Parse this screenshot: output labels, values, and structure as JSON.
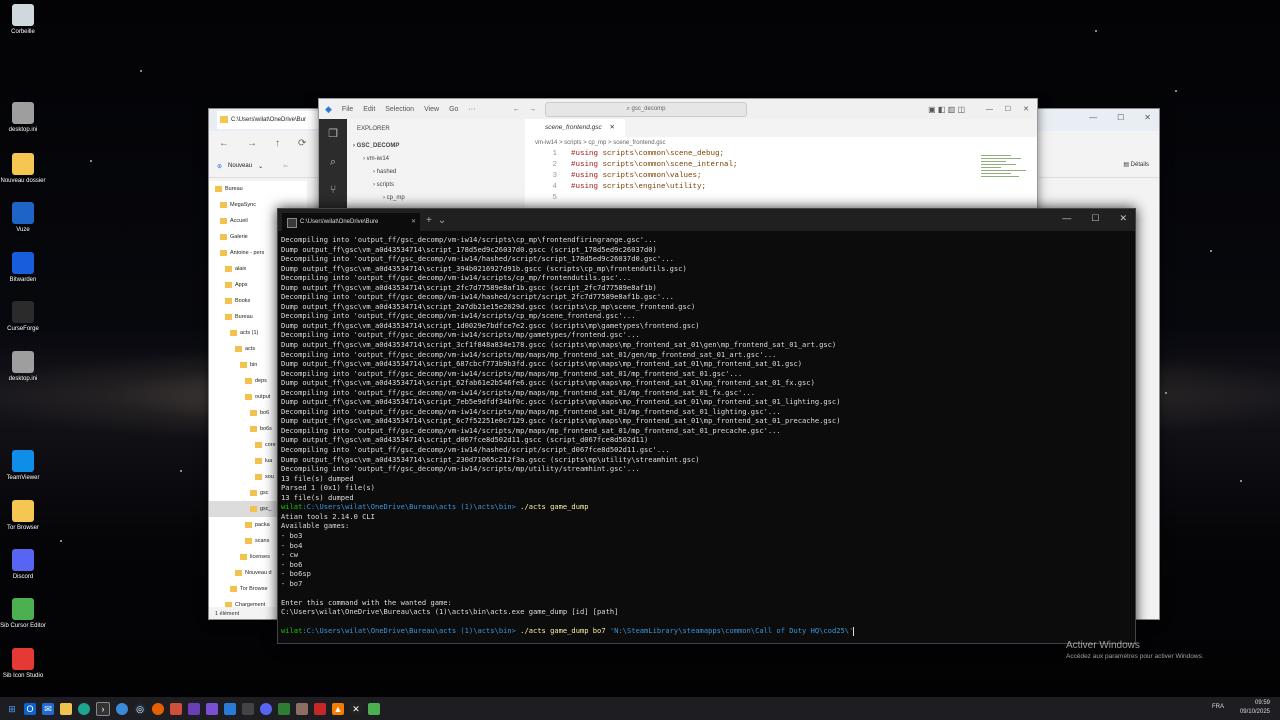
{
  "desktop": {
    "icons": [
      {
        "label": "Corbeille",
        "icon": "recycle-bin-icon",
        "color": "#cfd8dc"
      },
      {
        "label": "desktop.ini",
        "icon": "file-icon",
        "color": "#9e9e9e"
      },
      {
        "label": "Nouveau dossier",
        "icon": "folder-icon",
        "color": "#f6c652"
      },
      {
        "label": "Vuze",
        "icon": "vuze-icon",
        "color": "#1e63c6"
      },
      {
        "label": "Bitwarden",
        "icon": "bitwarden-icon",
        "color": "#175ddc"
      },
      {
        "label": "CurseForge",
        "icon": "curseforge-icon",
        "color": "#2b2b2b"
      },
      {
        "label": "desktop.ini",
        "icon": "file-icon",
        "color": "#9e9e9e"
      },
      {
        "label": "TeamViewer",
        "icon": "teamviewer-icon",
        "color": "#0e8ee9"
      },
      {
        "label": "Tor Browser",
        "icon": "folder-icon",
        "color": "#f6c652"
      },
      {
        "label": "Discord",
        "icon": "discord-icon",
        "color": "#5865f2"
      },
      {
        "label": "Sib Cursor Editor",
        "icon": "cursor-editor-icon",
        "color": "#4caf50"
      },
      {
        "label": "Sib Icon Studio",
        "icon": "icon-studio-icon",
        "color": "#e53935"
      }
    ]
  },
  "explorer": {
    "tab_title": "C:\\Users\\wilat\\OneDrive\\Bur",
    "new_label": "Nouveau",
    "details_label": "Détails",
    "status": "1 élément",
    "tree": [
      {
        "label": "Bureau",
        "indent": 0
      },
      {
        "label": "MegaSync",
        "indent": 1
      },
      {
        "label": "Accueil",
        "indent": 1
      },
      {
        "label": "Galerie",
        "indent": 1
      },
      {
        "label": "Antoine - pers",
        "indent": 1
      },
      {
        "label": "alaix",
        "indent": 2
      },
      {
        "label": "Apps",
        "indent": 2
      },
      {
        "label": "Books",
        "indent": 2
      },
      {
        "label": "Bureau",
        "indent": 2
      },
      {
        "label": "acts (1)",
        "indent": 3
      },
      {
        "label": "acts",
        "indent": 4
      },
      {
        "label": "bin",
        "indent": 5
      },
      {
        "label": "deps",
        "indent": 6
      },
      {
        "label": "output",
        "indent": 6
      },
      {
        "label": "bo6",
        "indent": 7
      },
      {
        "label": "bo6s",
        "indent": 7
      },
      {
        "label": "core",
        "indent": 8
      },
      {
        "label": "lua",
        "indent": 8
      },
      {
        "label": "sou",
        "indent": 8
      },
      {
        "label": "gsc",
        "indent": 7
      },
      {
        "label": "gsc_",
        "indent": 7
      },
      {
        "label": "packa",
        "indent": 6
      },
      {
        "label": "scans",
        "indent": 6
      },
      {
        "label": "licenses",
        "indent": 5
      },
      {
        "label": "Nouveau d",
        "indent": 4
      },
      {
        "label": "Tor Browse",
        "indent": 3
      },
      {
        "label": "Chargement",
        "indent": 2
      }
    ]
  },
  "vscode": {
    "menu": [
      "File",
      "Edit",
      "Selection",
      "View",
      "Go",
      "···"
    ],
    "search": "gsc_decomp",
    "explorer_label": "EXPLORER",
    "tree": [
      {
        "label": "GSC_DECOMP",
        "indent": 0
      },
      {
        "label": "vm-iw14",
        "indent": 1
      },
      {
        "label": "hashed",
        "indent": 2
      },
      {
        "label": "scripts",
        "indent": 2
      },
      {
        "label": "cp_mp",
        "indent": 3
      }
    ],
    "tab": "scene_frontend.gsc",
    "breadcrumb": "vm-iw14 > scripts > cp_mp > scene_frontend.gsc",
    "code": [
      {
        "n": "1",
        "kw": "#using",
        "path": "scripts\\common\\scene_debug;"
      },
      {
        "n": "2",
        "kw": "#using",
        "path": "scripts\\common\\scene_internal;"
      },
      {
        "n": "3",
        "kw": "#using",
        "path": "scripts\\common\\values;"
      },
      {
        "n": "4",
        "kw": "#using",
        "path": "scripts\\engine\\utility;"
      },
      {
        "n": "5",
        "kw": "",
        "path": ""
      }
    ]
  },
  "terminal": {
    "tab_title": "C:\\Users\\wilat\\OneDrive\\Bure",
    "lines": [
      "Decompiling into 'output_ff/gsc_decomp/vm-iw14/scripts\\cp_mp\\frontendfiringrange.gsc'...",
      "Dump output_ff\\gsc\\vm_a0d43534714\\script_178d5ed9c26037d0.gscc (script_178d5ed9c26037d0)",
      "Decompiling into 'output_ff/gsc_decomp/vm-iw14/hashed/script/script_178d5ed9c26037d0.gsc'...",
      "Dump output_ff\\gsc\\vm_a0d43534714\\script_394b0216927d91b.gscc (scripts\\cp_mp\\frontendutils.gsc)",
      "Decompiling into 'output_ff/gsc_decomp/vm-iw14/scripts/cp_mp/frontendutils.gsc'...",
      "Dump output_ff\\gsc\\vm_a0d43534714\\script_2fc7d77589e8af1b.gscc (script_2fc7d77589e8af1b)",
      "Decompiling into 'output_ff/gsc_decomp/vm-iw14/hashed/script/script_2fc7d77589e8af1b.gsc'...",
      "Dump output_ff\\gsc\\vm_a0d43534714\\script_2a7db21e15e2029d.gscc (scripts\\cp_mp\\scene_frontend.gsc)",
      "Decompiling into 'output_ff/gsc_decomp/vm-iw14/scripts/cp_mp/scene_frontend.gsc'...",
      "Dump output_ff\\gsc\\vm_a0d43534714\\script_1d0029e7bdfce7e2.gscc (scripts\\mp\\gametypes\\frontend.gsc)",
      "Decompiling into 'output_ff/gsc_decomp/vm-iw14/scripts/mp/gametypes/frontend.gsc'...",
      "Dump output_ff\\gsc\\vm_a0d43534714\\script_3cf1f848a834e178.gscc (scripts\\mp\\maps\\mp_frontend_sat_01\\gen\\mp_frontend_sat_01_art.gsc)",
      "Decompiling into 'output_ff/gsc_decomp/vm-iw14/scripts/mp/maps/mp_frontend_sat_01/gen/mp_frontend_sat_01_art.gsc'...",
      "Dump output_ff\\gsc\\vm_a0d43534714\\script_687cbcf773b9b3fd.gscc (scripts\\mp\\maps\\mp_frontend_sat_01\\mp_frontend_sat_01.gsc)",
      "Decompiling into 'output_ff/gsc_decomp/vm-iw14/scripts/mp/maps/mp_frontend_sat_01/mp_frontend_sat_01.gsc'...",
      "Dump output_ff\\gsc\\vm_a0d43534714\\script_62fab61e2b546fe6.gscc (scripts\\mp\\maps\\mp_frontend_sat_01\\mp_frontend_sat_01_fx.gsc)",
      "Decompiling into 'output_ff/gsc_decomp/vm-iw14/scripts/mp/maps/mp_frontend_sat_01/mp_frontend_sat_01_fx.gsc'...",
      "Dump output_ff\\gsc\\vm_a0d43534714\\script_7eb5e9dfdf34bf0c.gscc (scripts\\mp\\maps\\mp_frontend_sat_01\\mp_frontend_sat_01_lighting.gsc)",
      "Decompiling into 'output_ff/gsc_decomp/vm-iw14/scripts/mp/maps/mp_frontend_sat_01/mp_frontend_sat_01_lighting.gsc'...",
      "Dump output_ff\\gsc\\vm_a0d43534714\\script_6c7f52251e0c7129.gscc (scripts\\mp\\maps\\mp_frontend_sat_01\\mp_frontend_sat_01_precache.gsc)",
      "Decompiling into 'output_ff/gsc_decomp/vm-iw14/scripts/mp/maps/mp_frontend_sat_01/mp_frontend_sat_01_precache.gsc'...",
      "Dump output_ff\\gsc\\vm_a0d43534714\\script_d067fce8d502d11.gscc (script_d067fce8d502d11)",
      "Decompiling into 'output_ff/gsc_decomp/vm-iw14/hashed/script/script_d067fce8d502d11.gsc'...",
      "Dump output_ff\\gsc\\vm_a0d43534714\\script_230d71065c212f3a.gscc (scripts\\mp\\utility\\streamhint.gsc)",
      "Decompiling into 'output_ff/gsc_decomp/vm-iw14/scripts/mp/utility/streamhint.gsc'...",
      "13 file(s) dumped",
      "Parsed 1 (0x1) file(s)",
      "13 file(s) dumped"
    ],
    "prompt1": {
      "user": "wilat",
      "path": ":C:\\Users\\wilat\\OneDrive\\Bureau\\acts (1)\\acts\\bin>",
      "cmd": " ./acts game_dump"
    },
    "output2": [
      "Atian tools 2.14.0 CLI",
      "Available games:",
      "- bo3",
      "- bo4",
      "- cw",
      "- bo6",
      "- bo6sp",
      "- bo7",
      "",
      "Enter this command with the wanted game:",
      "C:\\Users\\wilat\\OneDrive\\Bureau\\acts (1)\\acts\\bin\\acts.exe game_dump [id] [path]"
    ],
    "prompt2": {
      "user": "wilat",
      "path": ":C:\\Users\\wilat\\OneDrive\\Bureau\\acts (1)\\acts\\bin>",
      "cmd": " ./acts game_dump bo7 ",
      "arg": "'N:\\SteamLibrary\\steamapps\\common\\Call of Duty HQ\\cod25\\'"
    }
  },
  "watermark": {
    "title": "Activer Windows",
    "subtitle": "Accédez aux paramètres pour activer Windows."
  },
  "taskbar": {
    "lang": "FRA",
    "time": "09:59",
    "date": "09/10/2025"
  },
  "colors": {
    "terminal_bg": "#0c0c0c",
    "prompt_user": "#16c60c",
    "prompt_path": "#3a96dd",
    "prompt_cmd": "#f9f1a5"
  }
}
